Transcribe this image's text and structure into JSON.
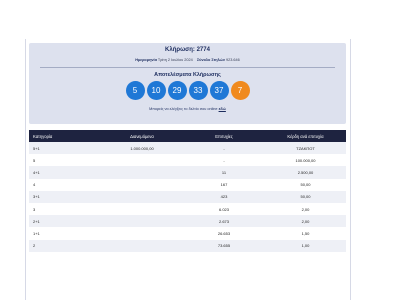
{
  "header": {
    "draw_label": "Κλήρωση: 2774",
    "date_label": "Ημερομηνία",
    "date_value": "Τρίτη 2 Ιουλίου 2024",
    "columns_label": "Σύνολο Στηλών",
    "columns_value": "923.646",
    "results_title": "Αποτελέσματα Κλήρωσης",
    "balls": [
      "5",
      "10",
      "29",
      "33",
      "37"
    ],
    "bonus_ball": "7",
    "check_text": "Μπορείς να ελέγξεις το δελτίο σου online",
    "check_link": "εδώ",
    "colors": {
      "main_ball": "#1f78d6",
      "bonus_ball": "#f08a1e",
      "header_bg": "#dde1ee",
      "table_head": "#1e2340"
    }
  },
  "table": {
    "headers": [
      "Κατηγορία",
      "Διανεμόμενα",
      "Επιτυχίες",
      "Κέρδη ανά επιτυχία"
    ],
    "rows": [
      [
        "5+1",
        "1.000.000,00",
        "-",
        "ΤΖΑΚΠΟΤ"
      ],
      [
        "5",
        "",
        "-",
        "100.000,00"
      ],
      [
        "4+1",
        "",
        "11",
        "2.500,00"
      ],
      [
        "4",
        "",
        "167",
        "50,00"
      ],
      [
        "3+1",
        "",
        "423",
        "50,00"
      ],
      [
        "3",
        "",
        "6.023",
        "2,00"
      ],
      [
        "2+1",
        "",
        "2.673",
        "2,00"
      ],
      [
        "1+1",
        "",
        "26.653",
        "1,50"
      ],
      [
        "2",
        "",
        "73.655",
        "1,00"
      ]
    ]
  }
}
